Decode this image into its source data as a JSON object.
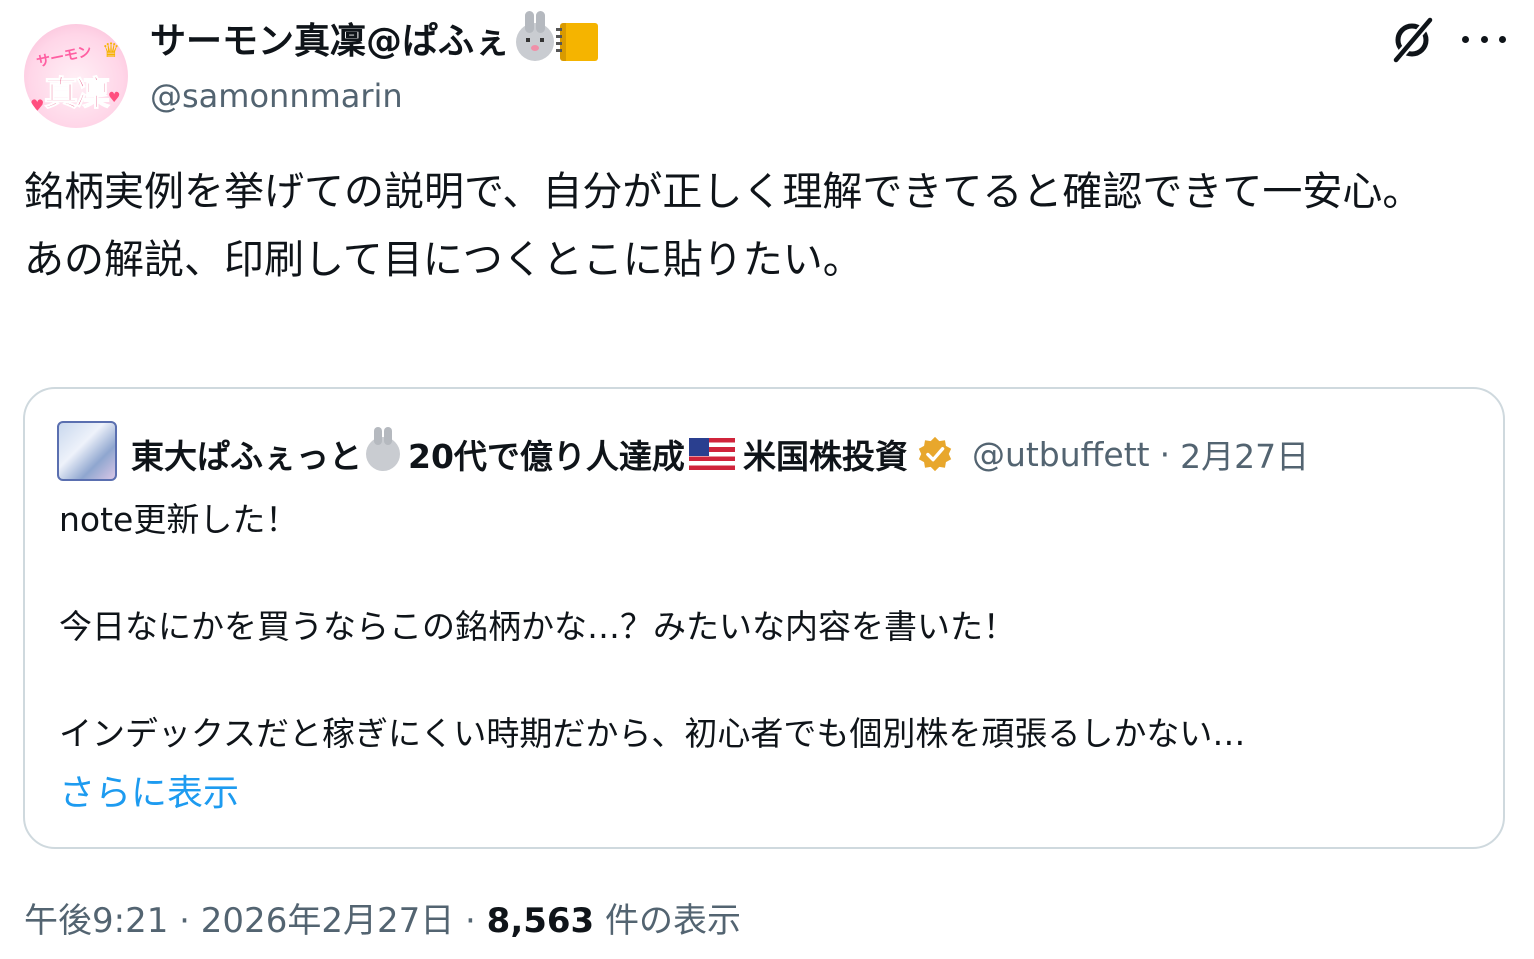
{
  "author": {
    "display_name": "サーモン真凜@ぱふぇ",
    "handle": "@samonnmarin",
    "avatar_text_top": "サーモン",
    "avatar_text_main": "真凜",
    "name_emojis": [
      "rabbit-face",
      "notebook"
    ]
  },
  "actions": {
    "grok_icon": "grok-icon",
    "more_icon": "more-icon"
  },
  "tweet": {
    "text": "銘柄実例を挙げての説明で、自分が正しく理解できてると確認できて一安心。\nあの解説、印刷して目につくとこに貼りたい。"
  },
  "quote": {
    "display_name_part1": "東大ぱふぇっと",
    "display_name_part2": "20代で億り人達成",
    "display_name_part3": "米国株投資",
    "handle": "@utbuffett",
    "separator": "·",
    "date": "2月27日",
    "text": "note更新した！\n\n今日なにかを買うならこの銘柄かな…？みたいな内容を書いた！\n\nインデックスだと稼ぎにくい時期だから、初心者でも個別株を頑張るしかない…",
    "show_more": "さらに表示",
    "verified_color": "#e8a72c"
  },
  "meta": {
    "time": "午後9:21",
    "separator": " · ",
    "date": "2026年2月27日",
    "views_count": "8,563",
    "views_label": " 件の表示"
  },
  "colors": {
    "text": "#0f1419",
    "secondary": "#536471",
    "link": "#1d9bf0",
    "border": "#cfd9de"
  }
}
